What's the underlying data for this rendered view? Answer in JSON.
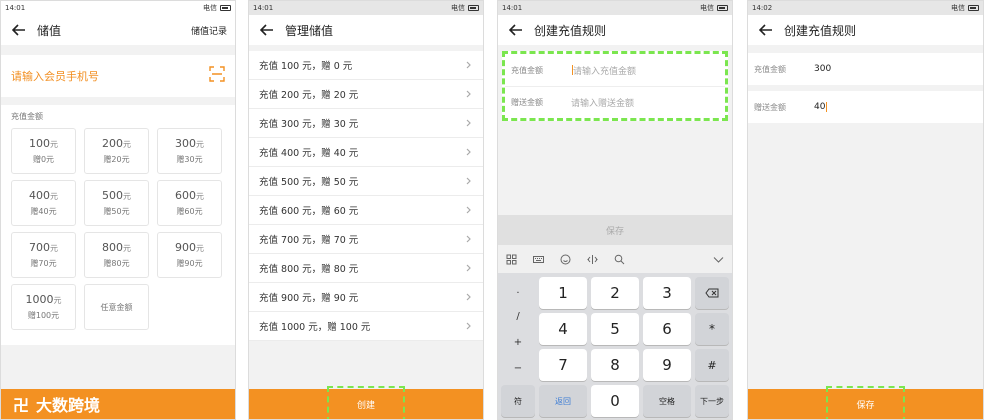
{
  "panel1": {
    "status_time": "14:01",
    "status_carrier": "电信",
    "title": "储值",
    "right_link": "储值记录",
    "member_placeholder": "请输入会员手机号",
    "section_label": "充值金额",
    "unit": "元",
    "amounts": [
      {
        "amount": "100",
        "gift": "赠0元"
      },
      {
        "amount": "200",
        "gift": "赠20元"
      },
      {
        "amount": "300",
        "gift": "赠30元"
      },
      {
        "amount": "400",
        "gift": "赠40元"
      },
      {
        "amount": "500",
        "gift": "赠50元"
      },
      {
        "amount": "600",
        "gift": "赠60元"
      },
      {
        "amount": "700",
        "gift": "赠70元"
      },
      {
        "amount": "800",
        "gift": "赠80元"
      },
      {
        "amount": "900",
        "gift": "赠90元"
      },
      {
        "amount": "1000",
        "gift": "赠100元"
      }
    ],
    "any_amount": "任意金额",
    "brand_text": "大数跨境",
    "brand_logo": "卍"
  },
  "panel2": {
    "status_time": "14:01",
    "status_carrier": "电信",
    "title": "管理储值",
    "rules": [
      "充值 100 元，赠 0 元",
      "充值 200 元，赠 20 元",
      "充值 300 元，赠 30 元",
      "充值 400 元，赠 40 元",
      "充值 500 元，赠 50 元",
      "充值 600 元，赠 60 元",
      "充值 700 元，赠 70 元",
      "充值 800 元，赠 80 元",
      "充值 900 元，赠 90 元",
      "充值 1000 元，赠 100 元"
    ],
    "create_label": "创建"
  },
  "panel3": {
    "status_time": "14:01",
    "status_carrier": "电信",
    "title": "创建充值规则",
    "recharge_label": "充值金额",
    "recharge_placeholder": "请输入充值金额",
    "gift_label": "赠送金额",
    "gift_placeholder": "请输入赠送金额",
    "save_label": "保存",
    "keys": {
      "k1": "1",
      "k2": "2",
      "k3": "3",
      "k4": "4",
      "k5": "5",
      "k6": "6",
      "k7": "7",
      "k8": "8",
      "k9": "9",
      "k0": "0",
      "star": "*",
      "hash": "#",
      "symbol": "符",
      "back": "返回",
      "space": "空格",
      "next": "下一步",
      "dot": ".",
      "slash": "/",
      "plus": "+",
      "minus": "−"
    }
  },
  "panel4": {
    "status_time": "14:02",
    "status_carrier": "电信",
    "title": "创建充值规则",
    "recharge_label": "充值金额",
    "recharge_value": "300",
    "gift_label": "赠送金额",
    "gift_value": "40",
    "save_label": "保存"
  },
  "colors": {
    "accent": "#f39122",
    "highlight": "#7be64f",
    "background": "#f2f2f2"
  }
}
